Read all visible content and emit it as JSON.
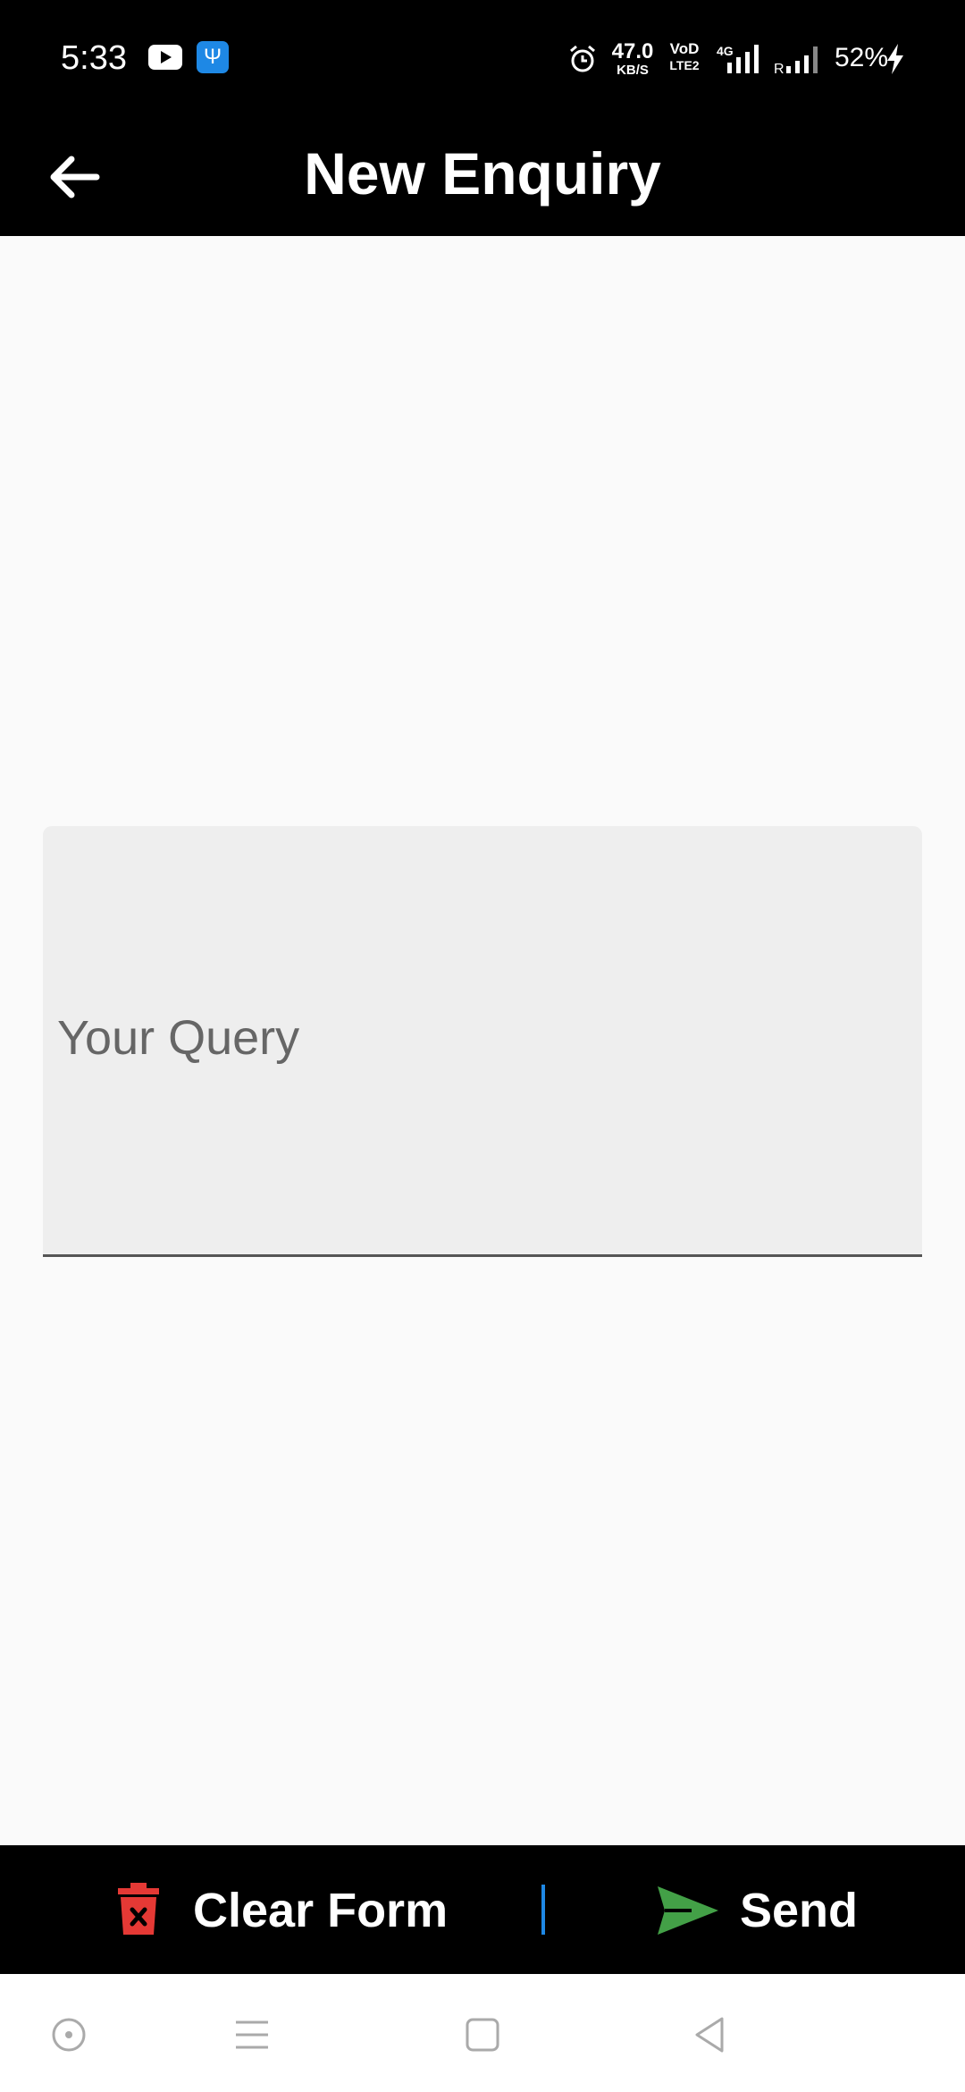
{
  "status_bar": {
    "time": "5:33",
    "net_speed_value": "47.0",
    "net_speed_unit": "KB/S",
    "volte_top": "VoD",
    "volte_bottom": "LTE2",
    "network_type": "4G",
    "roaming": "R",
    "battery": "52%"
  },
  "app_bar": {
    "title": "New Enquiry"
  },
  "form": {
    "query_placeholder": "Your Query"
  },
  "actions": {
    "clear_label": "Clear Form",
    "send_label": "Send"
  },
  "colors": {
    "trash": "#e53935",
    "send": "#43a047",
    "divider": "#1e88e5"
  }
}
